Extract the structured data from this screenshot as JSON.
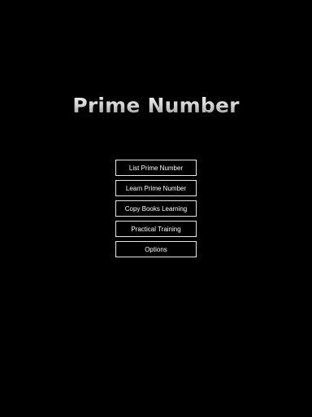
{
  "title": "Prime Number",
  "menu": [
    {
      "label": "List Prime Number"
    },
    {
      "label": "Learn Prime Number"
    },
    {
      "label": "Copy Books Learning"
    },
    {
      "label": "Practical Training"
    },
    {
      "label": "Options"
    }
  ],
  "colors": {
    "background": "#000000",
    "button_border": "#e6e6e6",
    "button_text": "#ffffff",
    "title": "#c9c9c9"
  }
}
